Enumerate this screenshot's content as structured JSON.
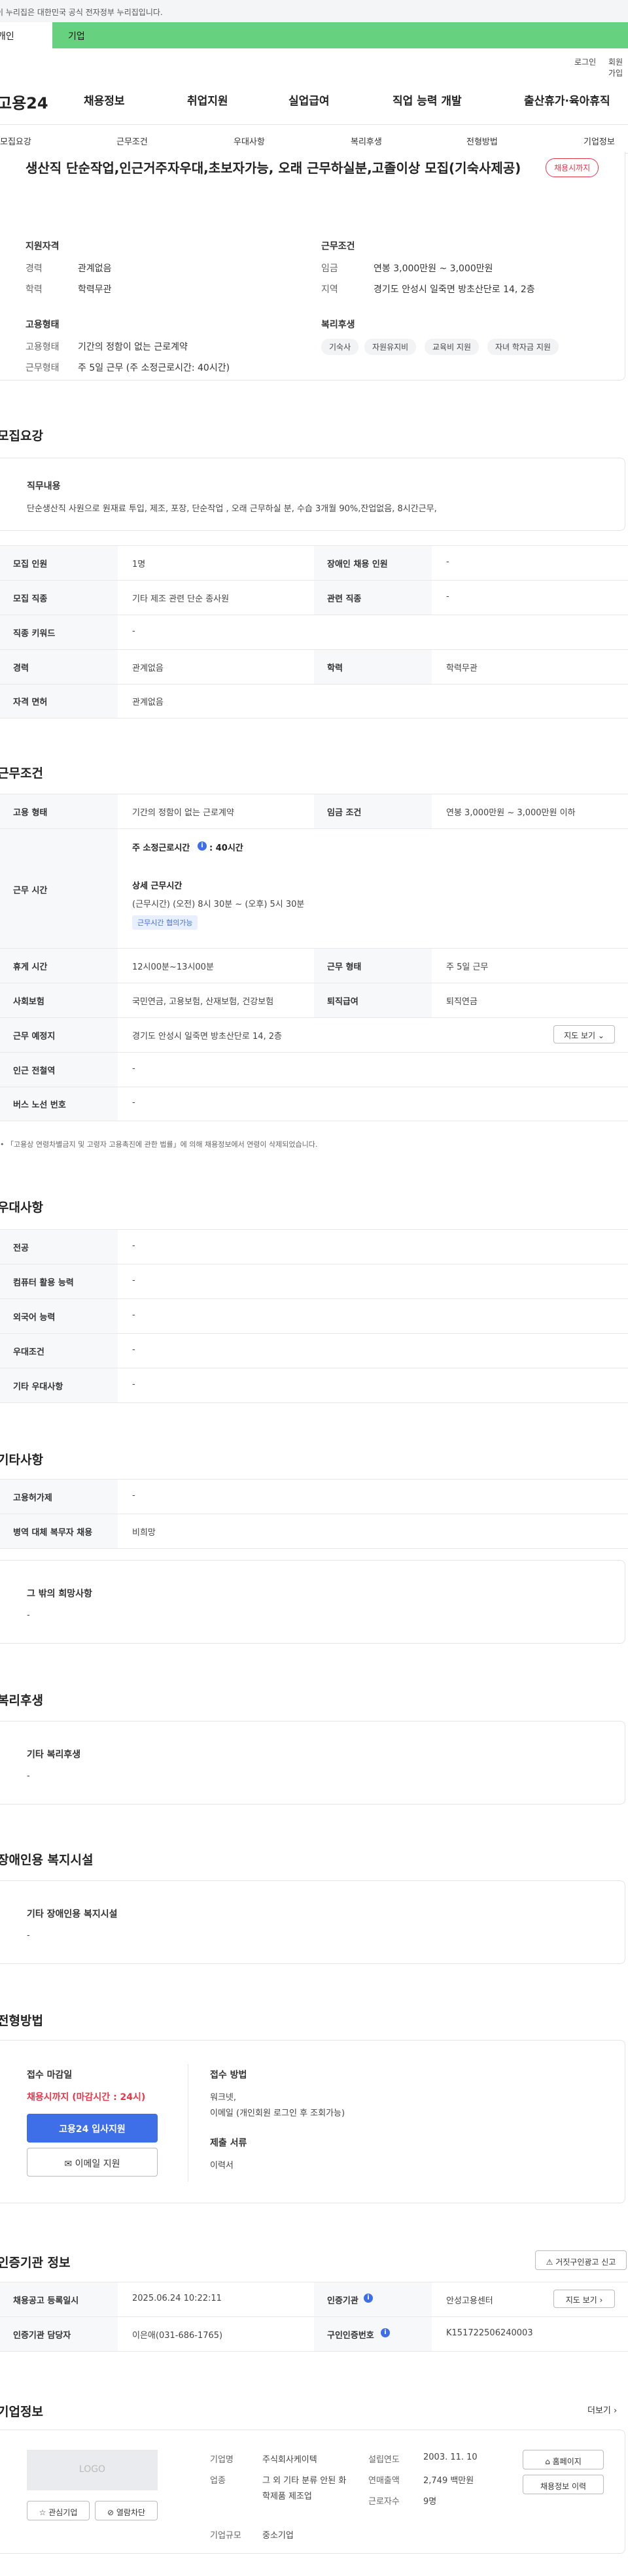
{
  "gov_notice": "이 누리집은 대한민국 공식 전자정부 누리집입니다.",
  "tabs": {
    "individual": "개인",
    "company": "기업"
  },
  "util": {
    "login": "로그인",
    "signup": "회원가입"
  },
  "logo": "고용24",
  "gnb": [
    "채용정보",
    "취업지원",
    "실업급여",
    "직업 능력 개발",
    "출산휴가·육아휴직"
  ],
  "snb": [
    "모집요강",
    "근무조건",
    "우대사항",
    "복리후생",
    "전형방법",
    "기업정보"
  ],
  "job": {
    "title": "생산직 단순작업,인근거주자우대,초보자가능, 오래 근무하실분,고졸이상 모집(기숙사제공)",
    "status_badge": "채용시까지",
    "qual_title": "지원자격",
    "career_key": "경력",
    "career_val": "관계없음",
    "edu_key": "학력",
    "edu_val": "학력무관",
    "cond_title": "근무조건",
    "wage_key": "임금",
    "wage_val": "연봉 3,000만원 ~ 3,000만원",
    "region_key": "지역",
    "region_val": "경기도 안성시 일죽면 방초산단로 14, 2층",
    "type_title": "고용형태",
    "emp_key": "고용형태",
    "emp_val": "기간의 정함이 없는 근로계약",
    "work_key": "근무형태",
    "work_val": "주 5일 근무 (주 소정근로시간: 40시간)",
    "welfare_title": "복리후생",
    "welfare_chips": [
      "기숙사",
      "자원유지비",
      "교육비 지원",
      "자녀 학자금 지원"
    ]
  },
  "recruit": {
    "title": "모집요강",
    "duty_title": "직무내용",
    "duty_text": "단순생산직 사원으로 원재료 투입, 제조, 포장, 단순작업 , 오래 근무하실 분, 수습 3개월 90%,잔업없음, 8시간근무,",
    "rows": [
      {
        "k1": "모집 인원",
        "v1": "1명",
        "k2": "장애인 채용 인원",
        "v2": "-"
      },
      {
        "k1": "모집 직종",
        "v1": "기타 제조 관련 단순 종사원",
        "k2": "관련 직종",
        "v2": "-"
      },
      {
        "k1": "직종 키워드",
        "v1": "-"
      },
      {
        "k1": "경력",
        "v1": "관계없음",
        "k2": "학력",
        "v2": "학력무관"
      },
      {
        "k1": "자격 면허",
        "v1": "관계없음"
      }
    ]
  },
  "conditions": {
    "title": "근무조건",
    "emp_key": "고용 형태",
    "emp_val": "기간의 정함이 없는 근로계약",
    "wage_key": "임금 조건",
    "wage_val": "연봉 3,000만원 ~ 3,000만원 이하",
    "hours_key": "근무 시간",
    "hours_main": "주 소정근로시간",
    "hours_main_val": ": 40시간",
    "hours_detail_title": "상세 근무시간",
    "hours_detail": "(근무시간) (오전) 8시 30분 ~ (오후) 5시 30분",
    "hours_tag": "근무시간 협의가능",
    "break_key": "휴게 시간",
    "break_val": "12시00분~13시00분",
    "form_key": "근무 형태",
    "form_val": "주 5일 근무",
    "ins_key": "사회보험",
    "ins_val": "국민연금, 고용보험, 산재보험, 건강보험",
    "ret_key": "퇴직급여",
    "ret_val": "퇴직연금",
    "place_key": "근무 예정지",
    "place_val": "경기도 안성시 일죽면 방초산단로 14, 2층",
    "map_btn": "지도 보기",
    "subway_key": "인근 전철역",
    "subway_val": "-",
    "bus_key": "버스 노선 번호",
    "bus_val": "-",
    "note": "「고용상 연령차별금지 및 고령자 고용촉진에 관한 법률」에 의해 채용정보에서 연령이 삭제되었습니다."
  },
  "prefer": {
    "title": "우대사항",
    "rows": [
      {
        "k": "전공",
        "v": "-"
      },
      {
        "k": "컴퓨터 활용 능력",
        "v": "-"
      },
      {
        "k": "외국어 능력",
        "v": "-"
      },
      {
        "k": "우대조건",
        "v": "-"
      },
      {
        "k": "기타 우대사항",
        "v": "-"
      }
    ]
  },
  "etc": {
    "title": "기타사항",
    "rows": [
      {
        "k": "고용허가제",
        "v": "-"
      },
      {
        "k": "병역 대체 복무자 채용",
        "v": "비희망"
      }
    ],
    "other_title": "그 밖의 희망사항",
    "other_val": "-"
  },
  "welfare": {
    "title": "복리후생",
    "box_title": "기타 복리후생",
    "box_val": "-"
  },
  "disabled": {
    "title": "장애인용 복지시설",
    "box_title": "기타 장애인용 복지시설",
    "box_val": "-"
  },
  "process": {
    "title": "전형방법",
    "deadline_title": "접수 마감일",
    "deadline_val": "채용시까지 (마감시간 : 24시)",
    "apply_btn": "고용24 입사지원",
    "email_btn": "이메일 지원",
    "method_title": "접수 방법",
    "method_val1": "워크넷,",
    "method_val2": "이메일 (개인회원 로그인 후 조회가능)",
    "doc_title": "제출 서류",
    "doc_val": "이력서"
  },
  "cert": {
    "title": "인증기관 정보",
    "report_btn": "거짓구인광고 신고",
    "reg_key": "채용공고 등록일시",
    "reg_val": "2025.06.24 10:22:11",
    "org_key": "인증기관",
    "org_val": "안성고용센터",
    "map_btn": "지도 보기",
    "mgr_key": "인증기관 담당자",
    "mgr_val": "이은애(031-686-1765)",
    "id_key": "구인인증번호",
    "id_val": "K151722506240003"
  },
  "company": {
    "title": "기업정보",
    "more": "더보기",
    "logo_text": "LOGO",
    "fav_btn": "관심기업",
    "block_btn": "열람차단",
    "name_key": "기업명",
    "name_val": "주식회사케이텍",
    "ind_key": "업종",
    "ind_val": "그 외 기타 분류 안된 화학제품 제조업",
    "size_key": "기업규모",
    "size_val": "중소기업",
    "year_key": "설립연도",
    "year_val": "2003. 11. 10",
    "sales_key": "연매출액",
    "sales_val": "2,749 백만원",
    "emp_key": "근로자수",
    "emp_val": "9명",
    "home_btn": "홈페이지",
    "history_btn": "채용정보 이력"
  },
  "colors": {
    "accent": "#3e6ee8",
    "green_tab": "#66d17e",
    "badge_red": "#e4394b"
  },
  "icons": [
    "info-icon",
    "chevron-down-icon",
    "chevron-right-icon",
    "star-icon",
    "mail-icon",
    "home-icon",
    "alert-icon"
  ]
}
